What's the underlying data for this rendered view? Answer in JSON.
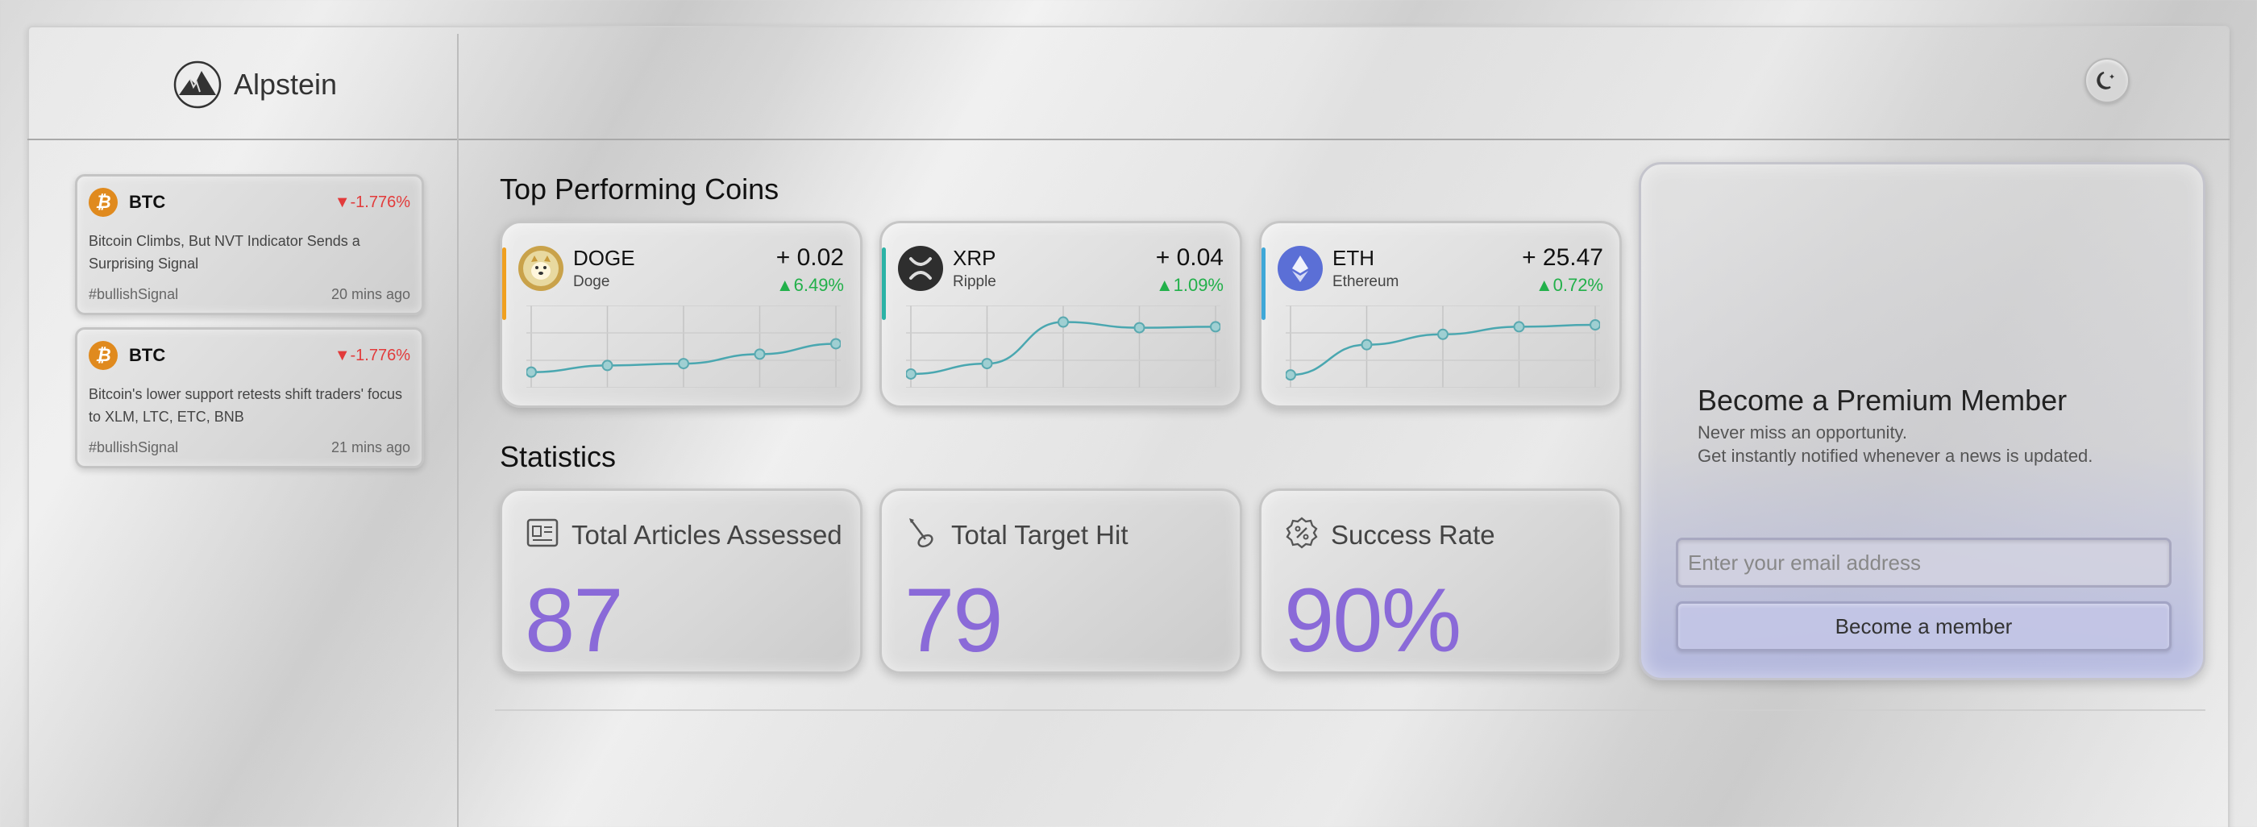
{
  "app": {
    "name": "Alpstein"
  },
  "header": {
    "theme_toggle": "moon-star-icon"
  },
  "news": [
    {
      "symbol": "BTC",
      "change": "▼-1.776%",
      "headline": "Bitcoin Climbs, But NVT Indicator Sends a Surprising Signal",
      "tag": "#bullishSignal",
      "time": "20 mins ago"
    },
    {
      "symbol": "BTC",
      "change": "▼-1.776%",
      "headline": "Bitcoin's lower support retests shift traders' focus to XLM, LTC, ETC, BNB",
      "tag": "#bullishSignal",
      "time": "21 mins ago"
    }
  ],
  "top_coins": {
    "title": "Top Performing Coins",
    "coins": [
      {
        "symbol": "DOGE",
        "name": "Doge",
        "value": "+ 0.02",
        "pct": "▲6.49%",
        "accent": "#f0a020",
        "logo_bg": "#c9a24a",
        "spark": [
          8,
          15,
          17,
          27,
          38
        ]
      },
      {
        "symbol": "XRP",
        "name": "Ripple",
        "value": "+ 0.04",
        "pct": "▲1.09%",
        "accent": "#2bb3a6",
        "logo_bg": "#333333",
        "spark": [
          6,
          17,
          61,
          55,
          56
        ]
      },
      {
        "symbol": "ETH",
        "name": "Ethereum",
        "value": "+ 25.47",
        "pct": "▲0.72%",
        "accent": "#3fa8d8",
        "logo_bg": "#5b6fd6",
        "spark": [
          5,
          37,
          48,
          56,
          58
        ]
      }
    ]
  },
  "statistics": {
    "title": "Statistics",
    "cards": [
      {
        "label": "Total Articles Assessed",
        "value": "87",
        "icon": "newspaper-icon"
      },
      {
        "label": "Total Target Hit",
        "value": "79",
        "icon": "target-hit-icon"
      },
      {
        "label": "Success Rate",
        "value": "90%",
        "icon": "percent-badge-icon"
      }
    ]
  },
  "premium": {
    "title": "Become a Premium Member",
    "line1": "Never miss an opportunity.",
    "line2": "Get instantly notified whenever a news is updated.",
    "email_placeholder": "Enter your email address",
    "button": "Become a member"
  }
}
